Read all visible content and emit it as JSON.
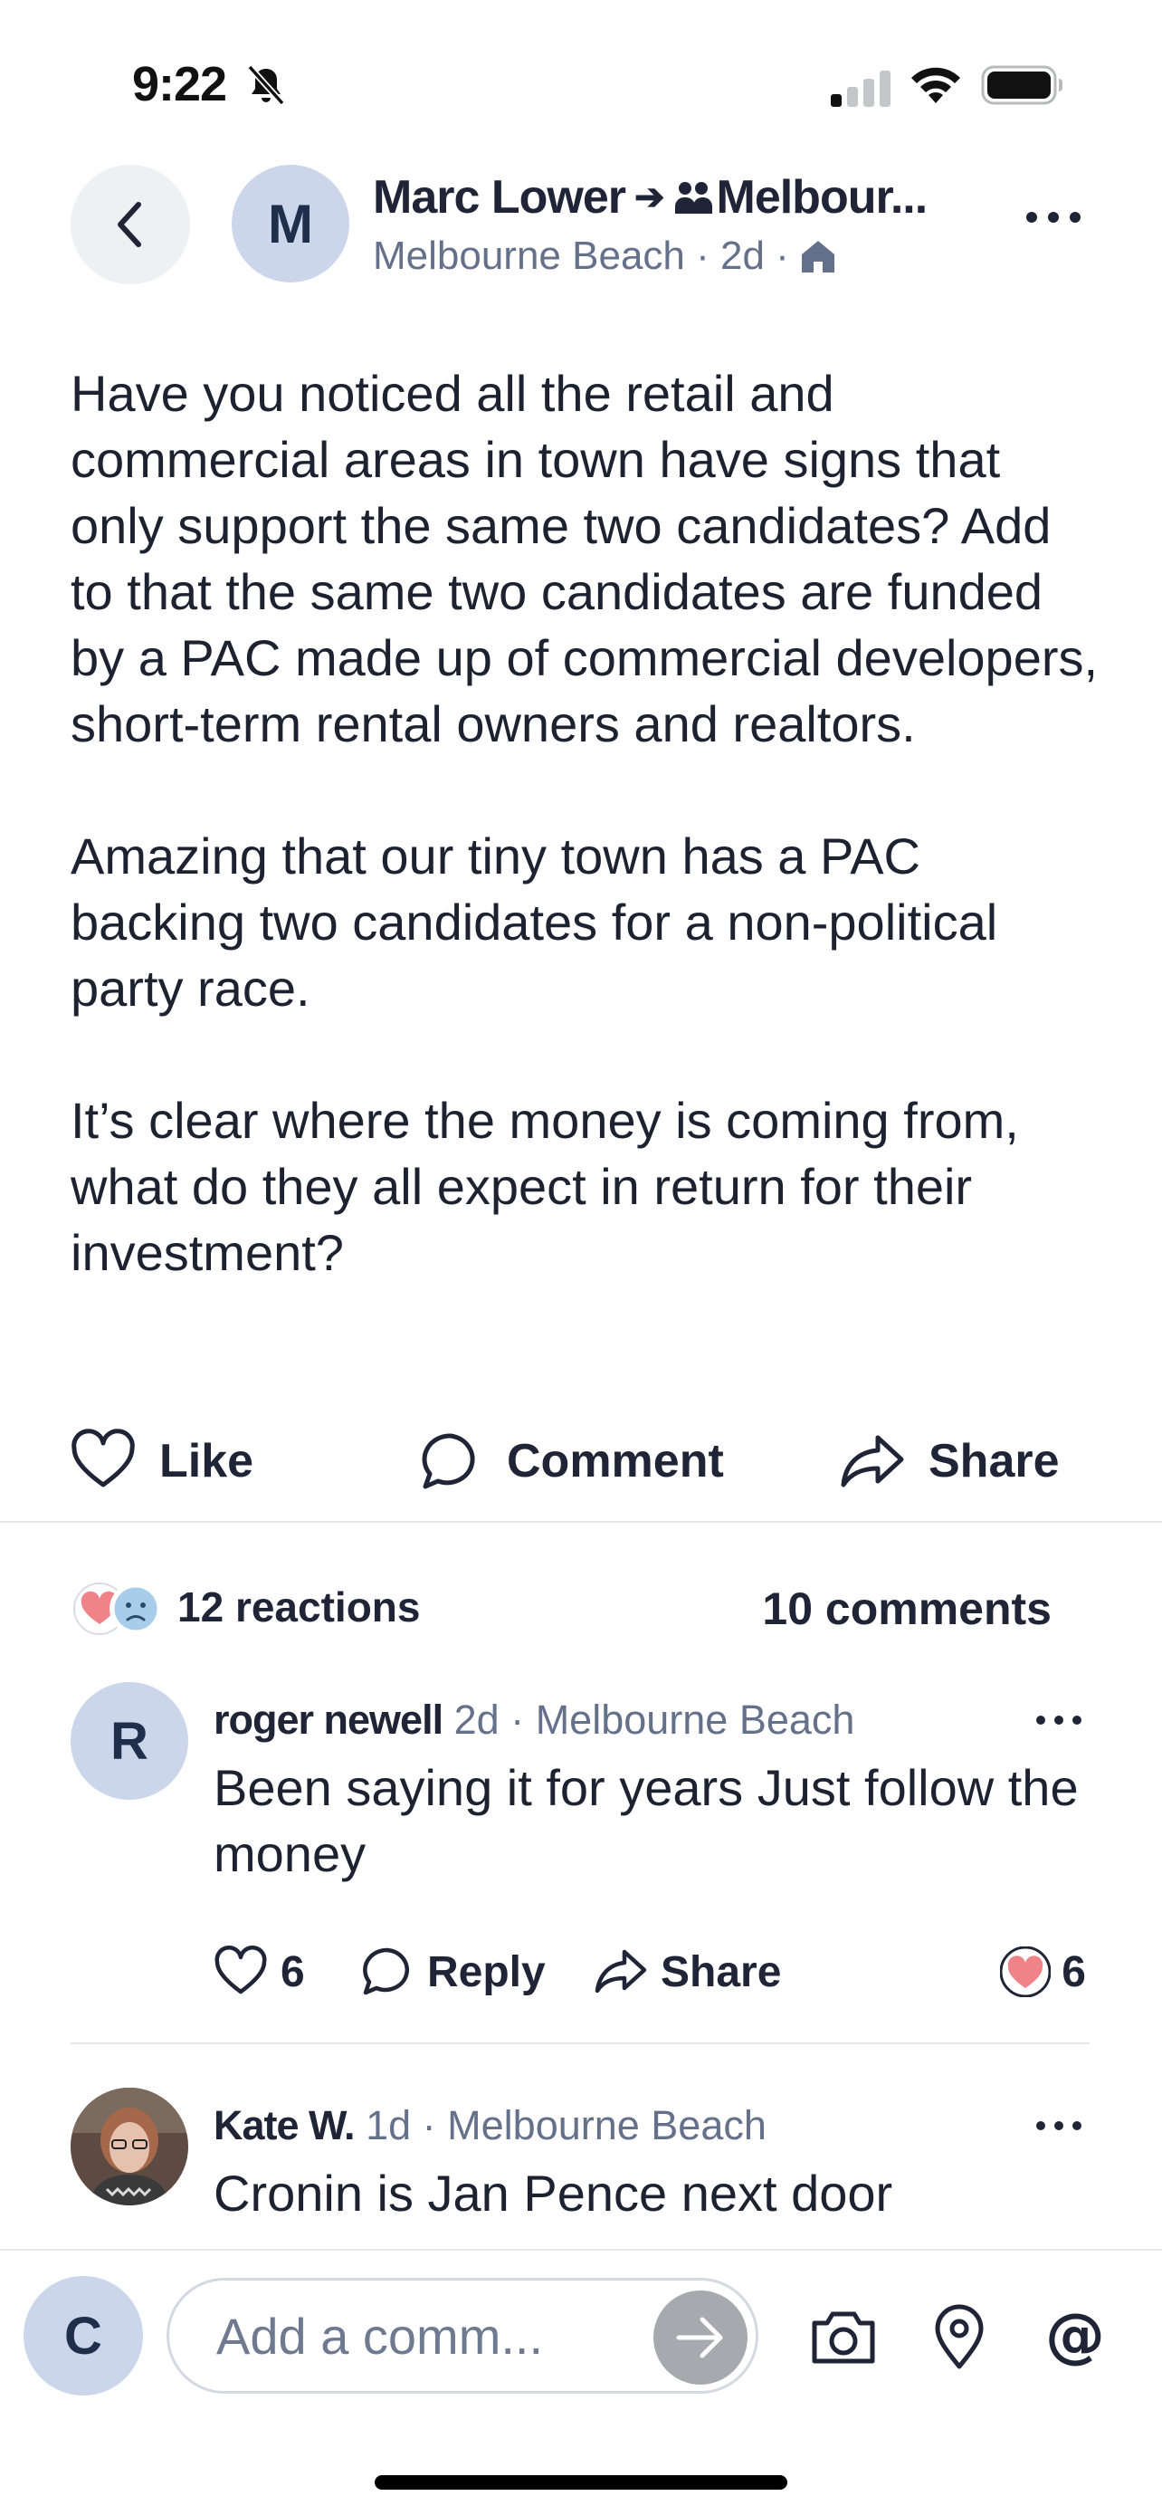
{
  "status_bar": {
    "time": "9:22"
  },
  "header": {
    "avatar_initial": "M",
    "author": "Marc Lower",
    "group": "Melbour...",
    "location": "Melbourne Beach",
    "age": "2d"
  },
  "post": {
    "paragraphs": [
      "Have you noticed all the retail and commercial areas in town have signs that only support the same two candidates?  Add to that the same two candidates are funded by a PAC made up of commercial developers, short-term rental owners and realtors.",
      "Amazing that our tiny town has a PAC backing two candidates for a non-political party race.",
      "It’s clear where the money is coming from, what do they all expect in return for their investment?"
    ]
  },
  "actions": {
    "like": "Like",
    "comment": "Comment",
    "share": "Share"
  },
  "stats": {
    "reactions": "12 reactions",
    "comments": "10 comments"
  },
  "comments": [
    {
      "avatar_initial": "R",
      "author": "roger newell",
      "age": "2d",
      "location": "Melbourne Beach",
      "text": "Been saying it for years   Just follow the money",
      "like_count": "6",
      "reply": "Reply",
      "share": "Share",
      "reaction_count": "6"
    },
    {
      "author": "Kate W.",
      "age": "1d",
      "location": "Melbourne Beach",
      "text": "Cronin is Jan Pence next door"
    }
  ],
  "composer": {
    "avatar_initial": "C",
    "placeholder": "Add a comm..."
  },
  "colors": {
    "text": "#1c2230",
    "muted": "#65708a",
    "avatar_bg": "#ccd6ea",
    "heart": "#f0828a",
    "send_button": "#a6a9ae"
  }
}
